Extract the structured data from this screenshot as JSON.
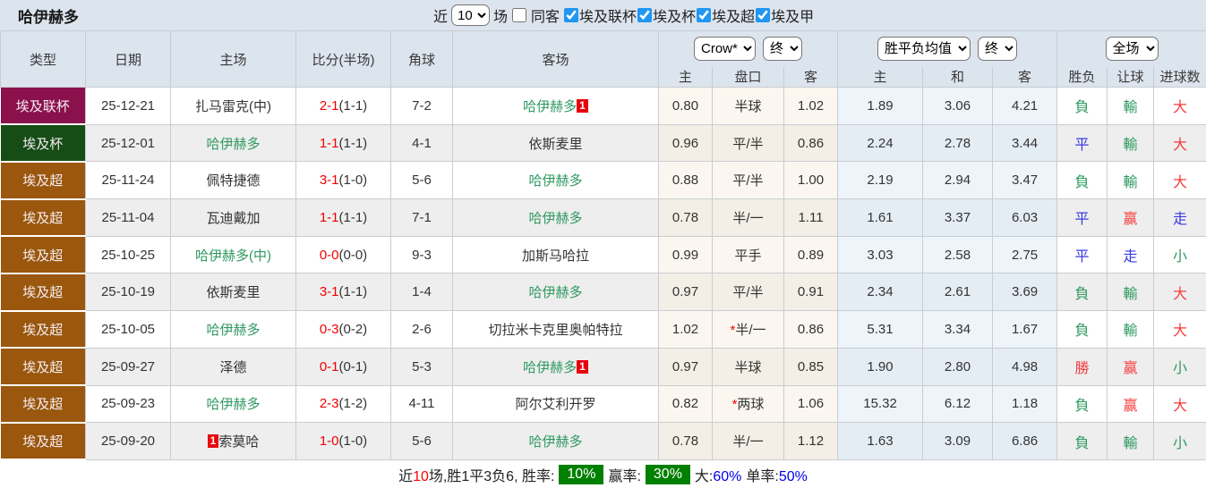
{
  "header": {
    "title": "哈伊赫多",
    "recent_label": "近",
    "recent_value": "10",
    "matches_label": "场",
    "same_away_label": "同客",
    "same_away_checked": false,
    "league_filters": [
      {
        "label": "埃及联杯",
        "checked": true
      },
      {
        "label": "埃及杯",
        "checked": true
      },
      {
        "label": "埃及超",
        "checked": true
      },
      {
        "label": "埃及甲",
        "checked": true
      }
    ]
  },
  "table": {
    "left_headers": [
      "类型",
      "日期",
      "主场",
      "比分(半场)",
      "角球",
      "客场"
    ],
    "selects": {
      "odds_source": "Crow*",
      "odds_time": "终",
      "mean_source": "胜平负均值",
      "mean_time": "终",
      "scope": "全场"
    },
    "sub_headers": [
      "主",
      "盘口",
      "客",
      "主",
      "和",
      "客",
      "胜负",
      "让球",
      "进球数"
    ],
    "rows": [
      {
        "type": "埃及联杯",
        "type_class": "t-leaguecup",
        "date": "25-12-21",
        "home": "扎马雷克(中)",
        "home_green": false,
        "home_badge": "",
        "score": "2-1",
        "half": "(1-1)",
        "corner": "7-2",
        "away": "哈伊赫多",
        "away_green": true,
        "away_badge": "1",
        "odds_home": "0.80",
        "handicap": "半球",
        "handicap_star": false,
        "odds_away": "1.02",
        "mean": [
          "1.89",
          "3.06",
          "4.21"
        ],
        "results": [
          {
            "text": "負",
            "color": "green"
          },
          {
            "text": "輸",
            "color": "green"
          },
          {
            "text": "大",
            "color": "red"
          }
        ]
      },
      {
        "type": "埃及杯",
        "type_class": "t-cup",
        "date": "25-12-01",
        "home": "哈伊赫多",
        "home_green": true,
        "home_badge": "",
        "score": "1-1",
        "half": "(1-1)",
        "corner": "4-1",
        "away": "依斯麦里",
        "away_green": false,
        "away_badge": "",
        "odds_home": "0.96",
        "handicap": "平/半",
        "handicap_star": false,
        "odds_away": "0.86",
        "mean": [
          "2.24",
          "2.78",
          "3.44"
        ],
        "results": [
          {
            "text": "平",
            "color": "blue"
          },
          {
            "text": "輸",
            "color": "green"
          },
          {
            "text": "大",
            "color": "red"
          }
        ]
      },
      {
        "type": "埃及超",
        "type_class": "t-super",
        "date": "25-11-24",
        "home": "佩特捷德",
        "home_green": false,
        "home_badge": "",
        "score": "3-1",
        "half": "(1-0)",
        "corner": "5-6",
        "away": "哈伊赫多",
        "away_green": true,
        "away_badge": "",
        "odds_home": "0.88",
        "handicap": "平/半",
        "handicap_star": false,
        "odds_away": "1.00",
        "mean": [
          "2.19",
          "2.94",
          "3.47"
        ],
        "results": [
          {
            "text": "負",
            "color": "green"
          },
          {
            "text": "輸",
            "color": "green"
          },
          {
            "text": "大",
            "color": "red"
          }
        ]
      },
      {
        "type": "埃及超",
        "type_class": "t-super",
        "date": "25-11-04",
        "home": "瓦迪戴加",
        "home_green": false,
        "home_badge": "",
        "score": "1-1",
        "half": "(1-1)",
        "corner": "7-1",
        "away": "哈伊赫多",
        "away_green": true,
        "away_badge": "",
        "odds_home": "0.78",
        "handicap": "半/一",
        "handicap_star": false,
        "odds_away": "1.11",
        "mean": [
          "1.61",
          "3.37",
          "6.03"
        ],
        "results": [
          {
            "text": "平",
            "color": "blue"
          },
          {
            "text": "赢",
            "color": "red"
          },
          {
            "text": "走",
            "color": "blue"
          }
        ]
      },
      {
        "type": "埃及超",
        "type_class": "t-super",
        "date": "25-10-25",
        "home": "哈伊赫多(中)",
        "home_green": true,
        "home_badge": "",
        "score": "0-0",
        "half": "(0-0)",
        "corner": "9-3",
        "away": "加斯马哈拉",
        "away_green": false,
        "away_badge": "",
        "odds_home": "0.99",
        "handicap": "平手",
        "handicap_star": false,
        "odds_away": "0.89",
        "mean": [
          "3.03",
          "2.58",
          "2.75"
        ],
        "results": [
          {
            "text": "平",
            "color": "blue"
          },
          {
            "text": "走",
            "color": "blue"
          },
          {
            "text": "小",
            "color": "green"
          }
        ]
      },
      {
        "type": "埃及超",
        "type_class": "t-super",
        "date": "25-10-19",
        "home": "依斯麦里",
        "home_green": false,
        "home_badge": "",
        "score": "3-1",
        "half": "(1-1)",
        "corner": "1-4",
        "away": "哈伊赫多",
        "away_green": true,
        "away_badge": "",
        "odds_home": "0.97",
        "handicap": "平/半",
        "handicap_star": false,
        "odds_away": "0.91",
        "mean": [
          "2.34",
          "2.61",
          "3.69"
        ],
        "results": [
          {
            "text": "負",
            "color": "green"
          },
          {
            "text": "輸",
            "color": "green"
          },
          {
            "text": "大",
            "color": "red"
          }
        ]
      },
      {
        "type": "埃及超",
        "type_class": "t-super",
        "date": "25-10-05",
        "home": "哈伊赫多",
        "home_green": true,
        "home_badge": "",
        "score": "0-3",
        "half": "(0-2)",
        "corner": "2-6",
        "away": "切拉米卡克里奥帕特拉",
        "away_green": false,
        "away_badge": "",
        "odds_home": "1.02",
        "handicap": "半/一",
        "handicap_star": true,
        "odds_away": "0.86",
        "mean": [
          "5.31",
          "3.34",
          "1.67"
        ],
        "results": [
          {
            "text": "負",
            "color": "green"
          },
          {
            "text": "輸",
            "color": "green"
          },
          {
            "text": "大",
            "color": "red"
          }
        ]
      },
      {
        "type": "埃及超",
        "type_class": "t-super",
        "date": "25-09-27",
        "home": "泽德",
        "home_green": false,
        "home_badge": "",
        "score": "0-1",
        "half": "(0-1)",
        "corner": "5-3",
        "away": "哈伊赫多",
        "away_green": true,
        "away_badge": "1",
        "odds_home": "0.97",
        "handicap": "半球",
        "handicap_star": false,
        "odds_away": "0.85",
        "mean": [
          "1.90",
          "2.80",
          "4.98"
        ],
        "results": [
          {
            "text": "勝",
            "color": "red"
          },
          {
            "text": "赢",
            "color": "red"
          },
          {
            "text": "小",
            "color": "green"
          }
        ]
      },
      {
        "type": "埃及超",
        "type_class": "t-super",
        "date": "25-09-23",
        "home": "哈伊赫多",
        "home_green": true,
        "home_badge": "",
        "score": "2-3",
        "half": "(1-2)",
        "corner": "4-11",
        "away": "阿尔艾利开罗",
        "away_green": false,
        "away_badge": "",
        "odds_home": "0.82",
        "handicap": "两球",
        "handicap_star": true,
        "odds_away": "1.06",
        "mean": [
          "15.32",
          "6.12",
          "1.18"
        ],
        "results": [
          {
            "text": "負",
            "color": "green"
          },
          {
            "text": "赢",
            "color": "red"
          },
          {
            "text": "大",
            "color": "red"
          }
        ]
      },
      {
        "type": "埃及超",
        "type_class": "t-super",
        "date": "25-09-20",
        "home": "索莫哈",
        "home_green": false,
        "home_badge": "1",
        "score": "1-0",
        "half": "(1-0)",
        "corner": "5-6",
        "away": "哈伊赫多",
        "away_green": true,
        "away_badge": "",
        "odds_home": "0.78",
        "handicap": "半/一",
        "handicap_star": false,
        "odds_away": "1.12",
        "mean": [
          "1.63",
          "3.09",
          "6.86"
        ],
        "results": [
          {
            "text": "負",
            "color": "green"
          },
          {
            "text": "輸",
            "color": "green"
          },
          {
            "text": "小",
            "color": "green"
          }
        ]
      }
    ]
  },
  "footer": {
    "prefix": "近",
    "count": "10",
    "summary": "场,胜1平3负6, 胜率:",
    "win_rate": "10%",
    "profit_label": "赢率:",
    "profit_rate": "30%",
    "big_label": "大:",
    "big_rate": "60%",
    "single_label": "单率:",
    "single_rate": "50%"
  },
  "colors": {
    "header_bg": "#dce4ee",
    "league_cup_badge": "#8b114d",
    "cup_badge": "#164d16",
    "super_badge": "#9a570d",
    "win_green": "#2e9960",
    "draw_blue": "#3a3ae0",
    "lose_red": "#f43d3d",
    "score_red": "#f00000",
    "rate_badge_green": "#008000",
    "checkbox_blue": "#2196f3"
  }
}
